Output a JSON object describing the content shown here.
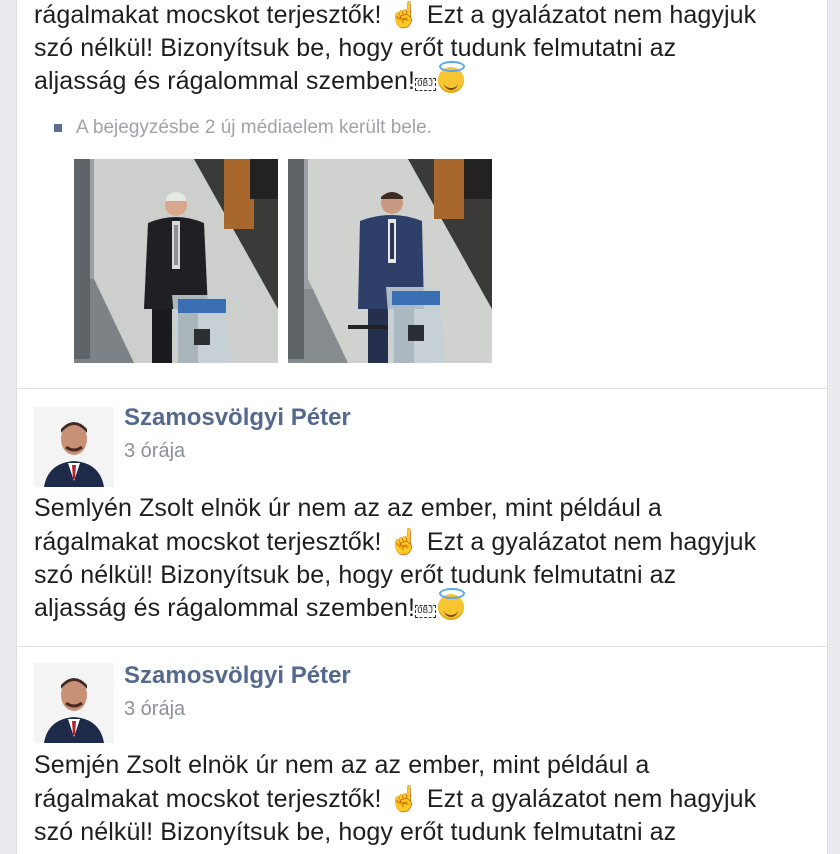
{
  "posts": [
    {
      "lines": [
        "rágalmakat mocskot terjesztők! ",
        "szó nélkül! Bizonyítsuk be, hogy erőt tudunk felmutatni az",
        "aljasság és rágalommal szemben!"
      ],
      "line1_after_emoji": " Ezt a gyalázatot nem hagyjuk",
      "obj_label": "OBJ",
      "media_note": "A bejegyzésbe 2 új médiaelem került bele."
    },
    {
      "author": "Szamosvölgyi Péter",
      "time": "3 órája",
      "lines": [
        "Semlyén Zsolt elnök úr nem az az ember, mint például a",
        "rágalmakat mocskot terjesztők! ",
        "szó nélkül! Bizonyítsuk be, hogy erőt tudunk felmutatni az",
        "aljasság és rágalommal szemben!"
      ],
      "line2_after_emoji": " Ezt a gyalázatot nem hagyjuk",
      "obj_label": "OBJ"
    },
    {
      "author": "Szamosvölgyi Péter",
      "time": "3 órája",
      "lines": [
        "Semjén Zsolt elnök úr nem az az ember, mint például a",
        "rágalmakat mocskot terjesztők! ",
        "szó nélkül! Bizonyítsuk be, hogy erőt tudunk felmutatni az"
      ],
      "line2_after_emoji": " Ezt a gyalázatot nem hagyjuk"
    }
  ],
  "icons": {
    "pointing": "pointing-up-hand-icon",
    "halo": "smiling-face-with-halo-icon"
  },
  "colors": {
    "author": "#55698e",
    "meta": "#8b9099",
    "text": "#1c1e21"
  }
}
